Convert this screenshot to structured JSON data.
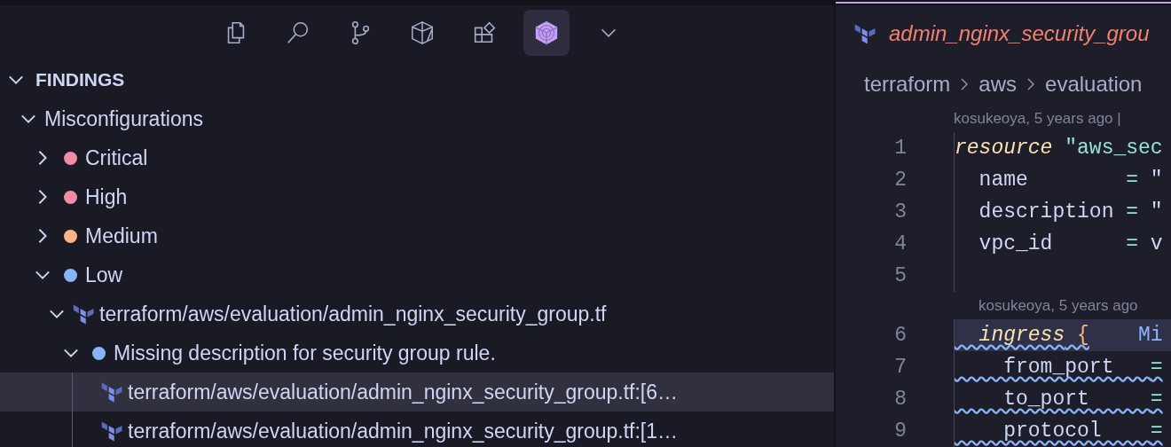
{
  "toolbar": {
    "items": [
      {
        "selected": false
      },
      {
        "selected": false
      },
      {
        "selected": false
      },
      {
        "selected": false
      },
      {
        "selected": false
      },
      {
        "selected": true
      },
      {
        "selected": false
      }
    ]
  },
  "sidebar": {
    "section": {
      "title": "FINDINGS",
      "expanded": true
    },
    "tree": [
      {
        "kind": "group",
        "label": "Misconfigurations",
        "expanded": true,
        "selected": false,
        "children": [
          {
            "kind": "severity",
            "label": "Critical",
            "color": "#f38ba8",
            "expanded": false,
            "selected": false
          },
          {
            "kind": "severity",
            "label": "High",
            "color": "#f38ba8",
            "expanded": false,
            "selected": false
          },
          {
            "kind": "severity",
            "label": "Medium",
            "color": "#fab387",
            "expanded": false,
            "selected": false
          },
          {
            "kind": "severity",
            "label": "Low",
            "color": "#89b4fa",
            "expanded": true,
            "selected": false,
            "children": [
              {
                "kind": "file",
                "label": "terraform/aws/evaluation/admin_nginx_security_group.tf",
                "expanded": true,
                "selected": false,
                "children": [
                  {
                    "kind": "finding",
                    "label": "Missing description for security group rule.",
                    "color": "#89b4fa",
                    "expanded": true,
                    "selected": false,
                    "children": [
                      {
                        "kind": "location",
                        "label": "terraform/aws/evaluation/admin_nginx_security_group.tf:[6…",
                        "selected": true
                      },
                      {
                        "kind": "location",
                        "label": "terraform/aws/evaluation/admin_nginx_security_group.tf:[1…",
                        "selected": false
                      }
                    ]
                  }
                ]
              }
            ]
          }
        ]
      }
    ]
  },
  "editor": {
    "tab": {
      "title": "admin_nginx_security_grou"
    },
    "breadcrumb": [
      "terraform",
      "aws",
      "evaluation"
    ],
    "lines": [
      {
        "kind": "blame",
        "text": "kosukeoya, 5 years ago |"
      },
      {
        "kind": "code",
        "number": "1",
        "highlighted": false,
        "squiggle": false,
        "tokens": [
          {
            "kind": "keyword",
            "text": "resource"
          },
          {
            "kind": "string",
            "text": " \"aws_sec"
          }
        ]
      },
      {
        "kind": "code",
        "number": "2",
        "highlighted": false,
        "squiggle": false,
        "tokens": [
          {
            "kind": "plain",
            "text": "  name        "
          },
          {
            "kind": "operator",
            "text": "="
          },
          {
            "kind": "plain",
            "text": " \""
          }
        ]
      },
      {
        "kind": "code",
        "number": "3",
        "highlighted": false,
        "squiggle": false,
        "tokens": [
          {
            "kind": "plain",
            "text": "  description "
          },
          {
            "kind": "operator",
            "text": "="
          },
          {
            "kind": "plain",
            "text": " \""
          }
        ]
      },
      {
        "kind": "code",
        "number": "4",
        "highlighted": false,
        "squiggle": false,
        "tokens": [
          {
            "kind": "plain",
            "text": "  vpc_id      "
          },
          {
            "kind": "operator",
            "text": "="
          },
          {
            "kind": "plain",
            "text": " v"
          }
        ]
      },
      {
        "kind": "code",
        "number": "5",
        "highlighted": false
      },
      {
        "kind": "blame",
        "text": "kosukeoya, 5 years ago"
      },
      {
        "kind": "code",
        "number": "6",
        "highlighted": true,
        "squiggle": true,
        "tokens": [
          {
            "kind": "keyword",
            "text": "  ingress"
          },
          {
            "kind": "brace",
            "text": " {"
          },
          {
            "kind": "diagnostic",
            "text": "    Mi"
          }
        ]
      },
      {
        "kind": "code",
        "number": "7",
        "highlighted": false,
        "squiggle": true,
        "tokens": [
          {
            "kind": "plain",
            "text": "    from_port   "
          },
          {
            "kind": "operator",
            "text": "="
          }
        ]
      },
      {
        "kind": "code",
        "number": "8",
        "highlighted": false,
        "squiggle": true,
        "tokens": [
          {
            "kind": "plain",
            "text": "    to_port     "
          },
          {
            "kind": "operator",
            "text": "="
          }
        ]
      },
      {
        "kind": "code",
        "number": "9",
        "highlighted": false,
        "squiggle": true,
        "tokens": [
          {
            "kind": "plain",
            "text": "    protocol    "
          },
          {
            "kind": "operator",
            "text": "="
          }
        ]
      }
    ]
  }
}
